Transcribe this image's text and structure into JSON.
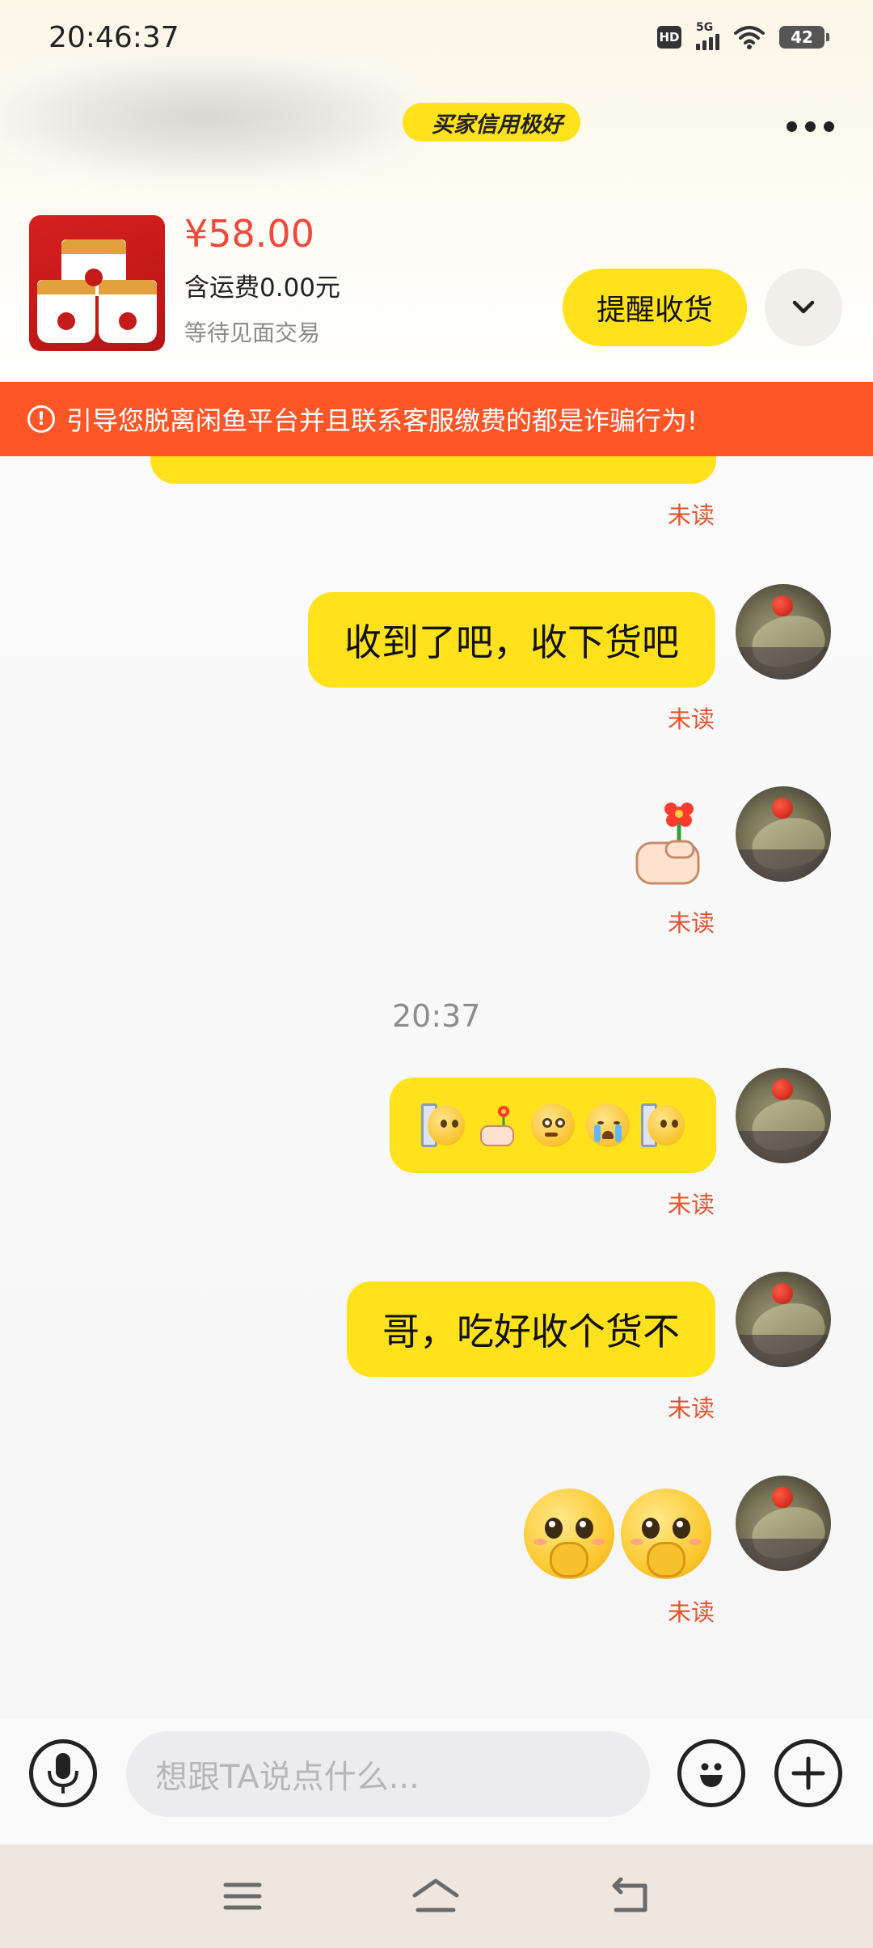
{
  "status_bar": {
    "time": "20:46:37",
    "hd": "HD",
    "network": "5G",
    "battery": "42"
  },
  "header": {
    "credit_badge": "买家信用极好"
  },
  "product": {
    "price": "¥58.00",
    "shipping": "含运费0.00元",
    "status": "等待见面交易",
    "remind_button": "提醒收货"
  },
  "warning": {
    "text": "引导您脱离闲鱼平台并且联系客服缴费的都是诈骗行为!"
  },
  "messages": [
    {
      "type": "text",
      "text": "收到了吧，收下货吧",
      "status": "未读"
    },
    {
      "type": "sticker",
      "sticker": "thumb-flower",
      "status": "未读"
    },
    {
      "type": "timestamp",
      "text": "20:37"
    },
    {
      "type": "emoji_row",
      "emojis": [
        "peek-face",
        "thumb-flower",
        "nervous-face",
        "crying-face",
        "peek-face"
      ],
      "status": "未读"
    },
    {
      "type": "text",
      "text": "哥，吃好收个货不",
      "status": "未读"
    },
    {
      "type": "emoji_pair",
      "emojis": [
        "pleading-face",
        "pleading-face"
      ],
      "status": "未读"
    }
  ],
  "input": {
    "placeholder": "想跟TA说点什么..."
  },
  "icons": {
    "voice": "microphone-icon",
    "emoji": "smile-icon",
    "plus": "plus-icon",
    "menu": "menu-icon",
    "home": "home-icon",
    "back": "back-icon"
  },
  "colors": {
    "accent_yellow": "#ffe21c",
    "price_red": "#f0483a",
    "warning_orange": "#ff5628",
    "unread_red": "#e8532e"
  }
}
